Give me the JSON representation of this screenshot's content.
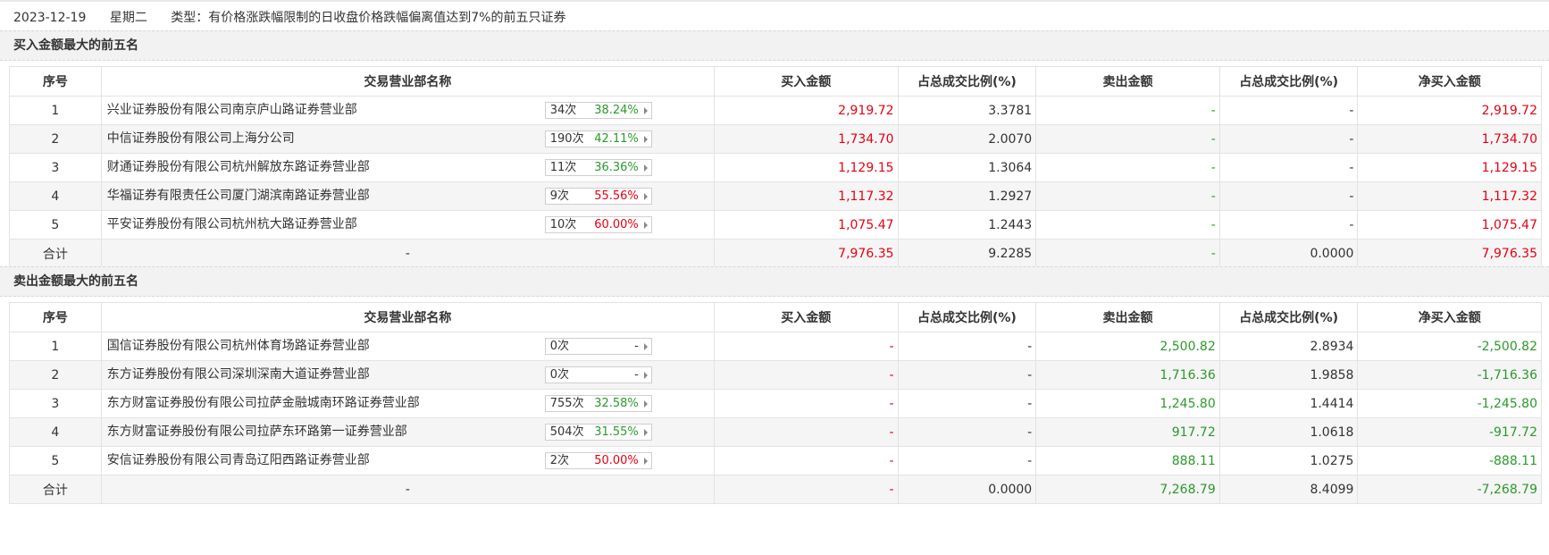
{
  "header": {
    "date": "2023-12-19",
    "weekday": "星期二",
    "type_text": "类型：有价格涨跌幅限制的日收盘价格跌幅偏离值达到7%的前五只证券"
  },
  "columns": [
    "序号",
    "交易营业部名称",
    "买入金额",
    "占总成交比例(%)",
    "卖出金额",
    "占总成交比例(%)",
    "净买入金额"
  ],
  "buy_section": {
    "title": "买入金额最大的前五名",
    "rows": [
      {
        "no": "1",
        "name": "兴业证券股份有限公司南京庐山路证券营业部",
        "count": "34次",
        "pct": "38.24%",
        "pct_color": "green",
        "buy": "2,919.72",
        "buy_ratio": "3.3781",
        "sell": "-",
        "sell_ratio": "-",
        "net": "2,919.72"
      },
      {
        "no": "2",
        "name": "中信证券股份有限公司上海分公司",
        "count": "190次",
        "pct": "42.11%",
        "pct_color": "green",
        "buy": "1,734.70",
        "buy_ratio": "2.0070",
        "sell": "-",
        "sell_ratio": "-",
        "net": "1,734.70"
      },
      {
        "no": "3",
        "name": "财通证券股份有限公司杭州解放东路证券营业部",
        "count": "11次",
        "pct": "36.36%",
        "pct_color": "green",
        "buy": "1,129.15",
        "buy_ratio": "1.3064",
        "sell": "-",
        "sell_ratio": "-",
        "net": "1,129.15"
      },
      {
        "no": "4",
        "name": "华福证券有限责任公司厦门湖滨南路证券营业部",
        "count": "9次",
        "pct": "55.56%",
        "pct_color": "red",
        "buy": "1,117.32",
        "buy_ratio": "1.2927",
        "sell": "-",
        "sell_ratio": "-",
        "net": "1,117.32"
      },
      {
        "no": "5",
        "name": "平安证券股份有限公司杭州杭大路证券营业部",
        "count": "10次",
        "pct": "60.00%",
        "pct_color": "red",
        "buy": "1,075.47",
        "buy_ratio": "1.2443",
        "sell": "-",
        "sell_ratio": "-",
        "net": "1,075.47"
      }
    ],
    "total": {
      "label": "合计",
      "name": "-",
      "buy": "7,976.35",
      "buy_ratio": "9.2285",
      "sell": "-",
      "sell_ratio": "0.0000",
      "net": "7,976.35"
    }
  },
  "sell_section": {
    "title": "卖出金额最大的前五名",
    "rows": [
      {
        "no": "1",
        "name": "国信证券股份有限公司杭州体育场路证券营业部",
        "count": "0次",
        "pct": "-",
        "pct_color": "dash",
        "buy": "-",
        "buy_ratio": "-",
        "sell": "2,500.82",
        "sell_ratio": "2.8934",
        "net": "-2,500.82"
      },
      {
        "no": "2",
        "name": "东方证券股份有限公司深圳深南大道证券营业部",
        "count": "0次",
        "pct": "-",
        "pct_color": "dash",
        "buy": "-",
        "buy_ratio": "-",
        "sell": "1,716.36",
        "sell_ratio": "1.9858",
        "net": "-1,716.36"
      },
      {
        "no": "3",
        "name": "东方财富证券股份有限公司拉萨金融城南环路证券营业部",
        "count": "755次",
        "pct": "32.58%",
        "pct_color": "green",
        "buy": "-",
        "buy_ratio": "-",
        "sell": "1,245.80",
        "sell_ratio": "1.4414",
        "net": "-1,245.80"
      },
      {
        "no": "4",
        "name": "东方财富证券股份有限公司拉萨东环路第一证券营业部",
        "count": "504次",
        "pct": "31.55%",
        "pct_color": "green",
        "buy": "-",
        "buy_ratio": "-",
        "sell": "917.72",
        "sell_ratio": "1.0618",
        "net": "-917.72"
      },
      {
        "no": "5",
        "name": "安信证券股份有限公司青岛辽阳西路证券营业部",
        "count": "2次",
        "pct": "50.00%",
        "pct_color": "red",
        "buy": "-",
        "buy_ratio": "-",
        "sell": "888.11",
        "sell_ratio": "1.0275",
        "net": "-888.11"
      }
    ],
    "total": {
      "label": "合计",
      "name": "-",
      "buy": "-",
      "buy_ratio": "0.0000",
      "sell": "7,268.79",
      "sell_ratio": "8.4099",
      "net": "-7,268.79"
    }
  },
  "colors": {
    "up": "#e60012",
    "down": "#2a9a2a",
    "border": "#e3e3e3",
    "stripe": "#f5f5f5",
    "bar": "#f2f2f2"
  }
}
